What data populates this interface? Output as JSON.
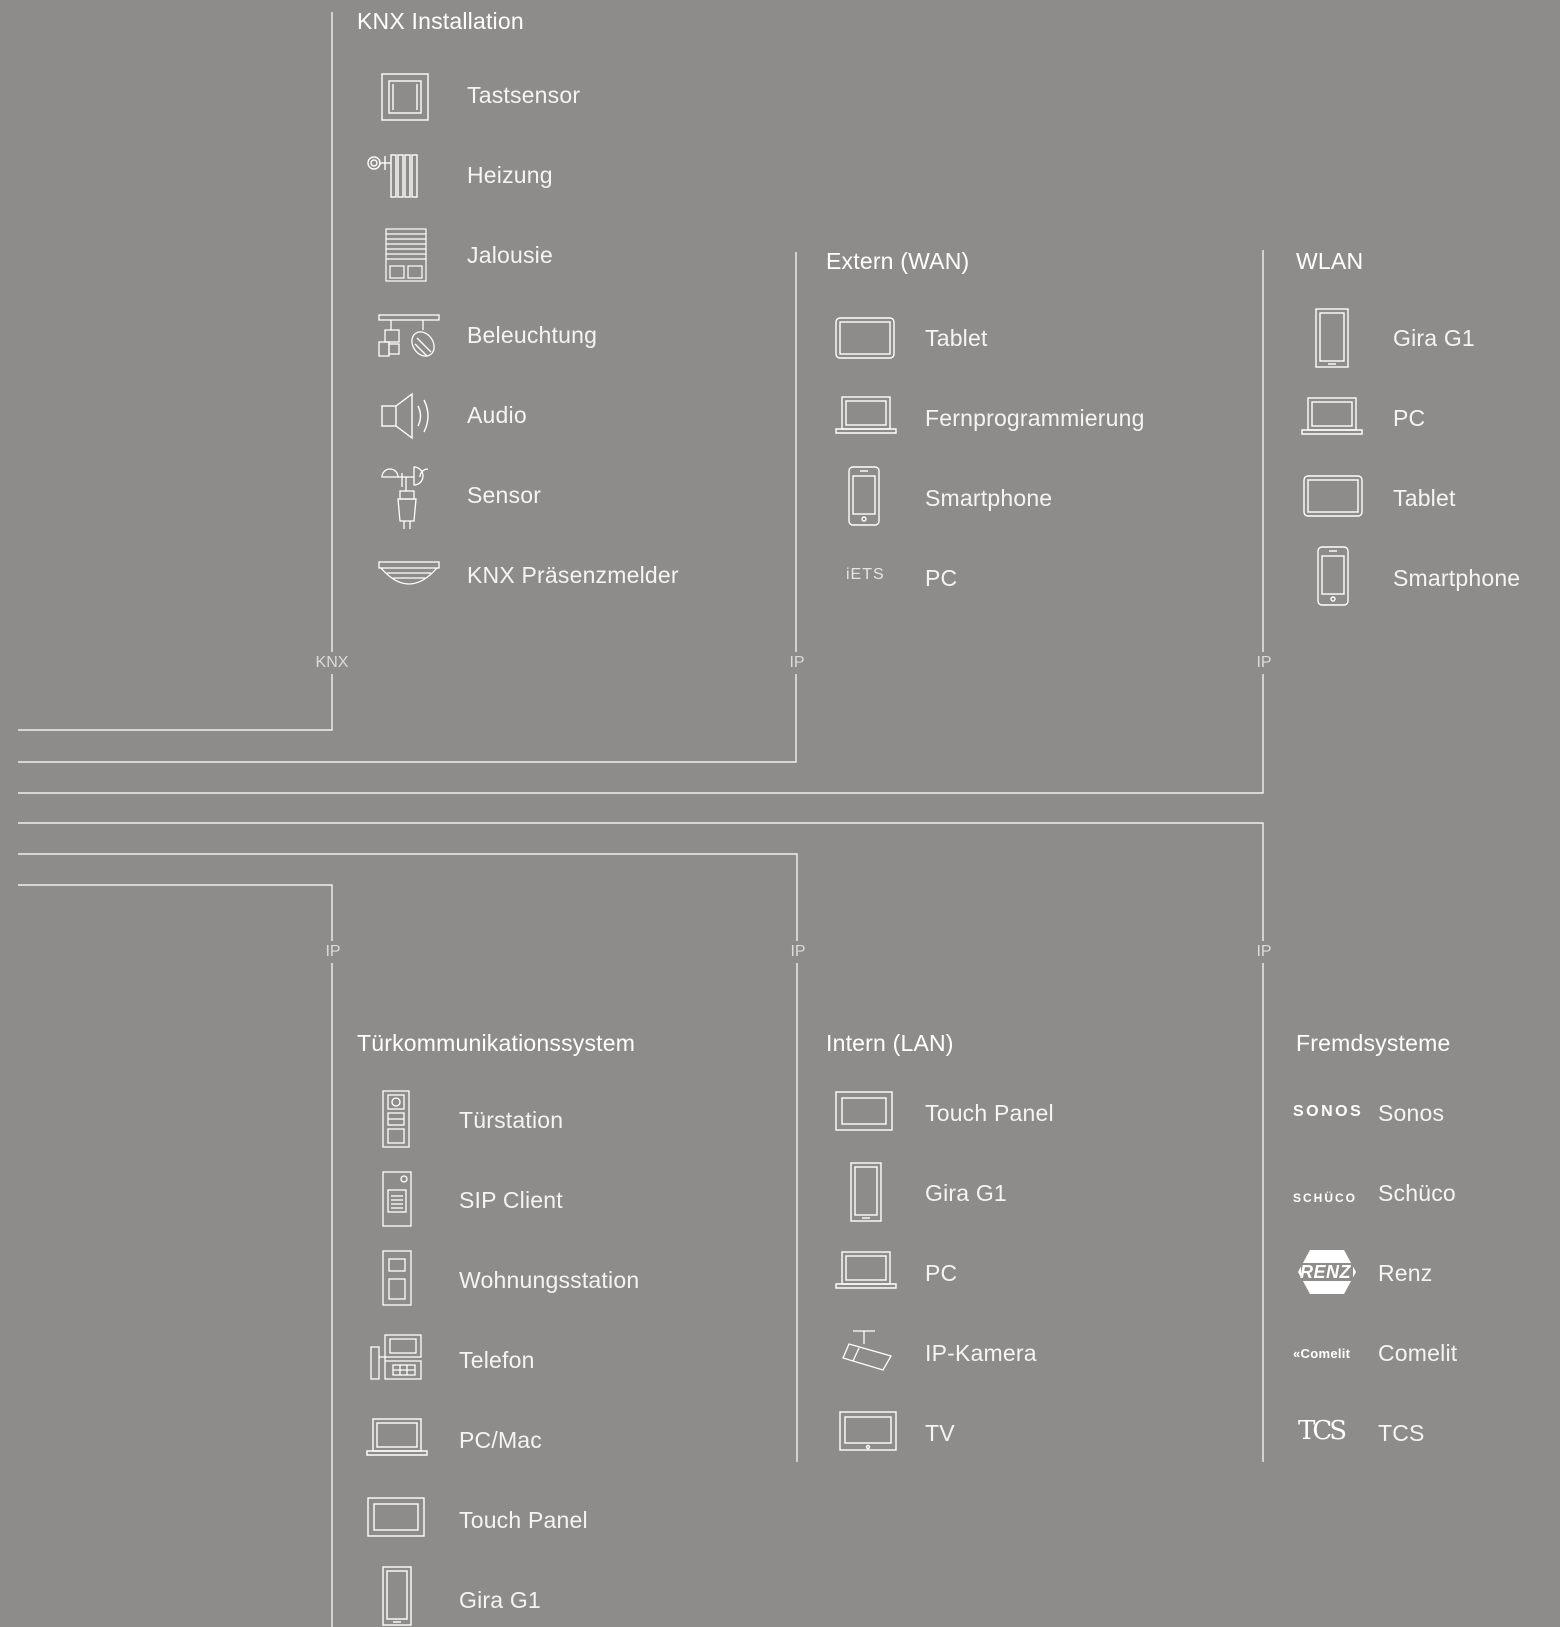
{
  "sections": {
    "knx": {
      "title": "KNX Installation",
      "bus": "KNX",
      "items": [
        {
          "label": "Tastsensor",
          "icon": "push-button-icon"
        },
        {
          "label": "Heizung",
          "icon": "radiator-icon"
        },
        {
          "label": "Jalousie",
          "icon": "blind-icon"
        },
        {
          "label": "Beleuchtung",
          "icon": "spotlight-icon"
        },
        {
          "label": "Audio",
          "icon": "speaker-icon"
        },
        {
          "label": "Sensor",
          "icon": "weather-sensor-icon"
        },
        {
          "label": "KNX Präsenzmelder",
          "icon": "presence-detector-icon"
        }
      ]
    },
    "wan": {
      "title": "Extern (WAN)",
      "bus": "IP",
      "items": [
        {
          "label": "Tablet",
          "icon": "tablet-icon"
        },
        {
          "label": "Fernprogrammierung",
          "icon": "laptop-icon"
        },
        {
          "label": "Smartphone",
          "icon": "smartphone-icon"
        },
        {
          "label": "PC",
          "icon": "iets-icon",
          "icon_text": "iETS"
        }
      ]
    },
    "wlan": {
      "title": "WLAN",
      "bus": "IP",
      "items": [
        {
          "label": "Gira G1",
          "icon": "gira-g1-icon"
        },
        {
          "label": "PC",
          "icon": "laptop-icon"
        },
        {
          "label": "Tablet",
          "icon": "tablet-icon"
        },
        {
          "label": "Smartphone",
          "icon": "smartphone-icon"
        }
      ]
    },
    "door": {
      "title": "Türkommunikationssystem",
      "bus": "IP",
      "items": [
        {
          "label": "Türstation",
          "icon": "door-station-icon"
        },
        {
          "label": "SIP Client",
          "icon": "sip-client-icon"
        },
        {
          "label": "Wohnungsstation",
          "icon": "apartment-station-icon"
        },
        {
          "label": "Telefon",
          "icon": "telephone-icon"
        },
        {
          "label": "PC/Mac",
          "icon": "laptop-icon"
        },
        {
          "label": "Touch Panel",
          "icon": "touch-panel-icon"
        },
        {
          "label": "Gira G1",
          "icon": "gira-g1-icon"
        }
      ]
    },
    "lan": {
      "title": "Intern (LAN)",
      "bus": "IP",
      "items": [
        {
          "label": "Touch Panel",
          "icon": "touch-panel-icon"
        },
        {
          "label": "Gira G1",
          "icon": "gira-g1-icon"
        },
        {
          "label": "PC",
          "icon": "laptop-icon"
        },
        {
          "label": "IP-Kamera",
          "icon": "ip-camera-icon"
        },
        {
          "label": "TV",
          "icon": "tv-icon"
        }
      ]
    },
    "third": {
      "title": "Fremdsysteme",
      "bus": "IP",
      "items": [
        {
          "label": "Sonos",
          "icon": "sonos-logo-icon",
          "icon_text": "SONOS"
        },
        {
          "label": "Schüco",
          "icon": "schueco-logo-icon",
          "icon_text": "SCHÜCO"
        },
        {
          "label": "Renz",
          "icon": "renz-logo-icon",
          "icon_text": "RENZ"
        },
        {
          "label": "Comelit",
          "icon": "comelit-logo-icon",
          "icon_text": "«Comelit"
        },
        {
          "label": "TCS",
          "icon": "tcs-logo-icon",
          "icon_text": "TCS"
        }
      ]
    }
  },
  "colors": {
    "background": "#8d8c8a",
    "line": "#ffffff",
    "text": "#ffffff"
  }
}
